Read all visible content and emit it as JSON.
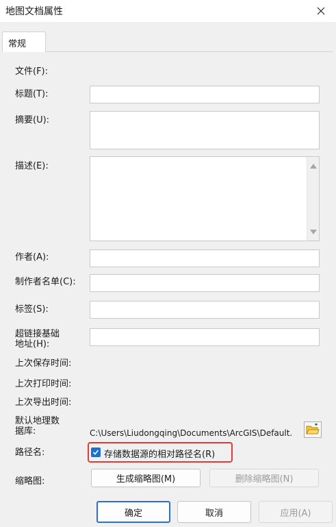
{
  "window": {
    "title": "地图文档属性"
  },
  "tab": {
    "label": "常规"
  },
  "labels": {
    "file": "文件(F):",
    "title": "标题(T):",
    "summary": "摘要(U):",
    "description": "描述(E):",
    "author": "作者(A):",
    "credits": "制作者名单(C):",
    "tags": "标签(S):",
    "hyperlink_base_line1": "超链接基础",
    "hyperlink_base_line2": "地址(H):",
    "last_saved": "上次保存时间:",
    "last_printed": "上次打印时间:",
    "last_exported": "上次导出时间:",
    "default_gdb_line1": "默认地理数",
    "default_gdb_line2": "据库:",
    "pathnames": "路径名:",
    "thumbnail": "缩略图:"
  },
  "fields": {
    "title": "",
    "summary": "",
    "description": "",
    "author": "",
    "credits": "",
    "tags": "",
    "hyperlink_base": ""
  },
  "default_gdb_path": "C:\\Users\\Liudongqing\\Documents\\ArcGIS\\Default.",
  "store_relative_paths": {
    "label": "存储数据源的相对路径名(R)",
    "checked": true
  },
  "buttons": {
    "make_thumbnail": "生成缩略图(M)",
    "delete_thumbnail": "删除缩略图(N)",
    "ok": "确定",
    "cancel": "取消",
    "apply": "应用(A)"
  },
  "colors": {
    "checkbox": "#1f6fd1",
    "highlight": "#e53935",
    "default_button_border": "#2b6fd6"
  }
}
